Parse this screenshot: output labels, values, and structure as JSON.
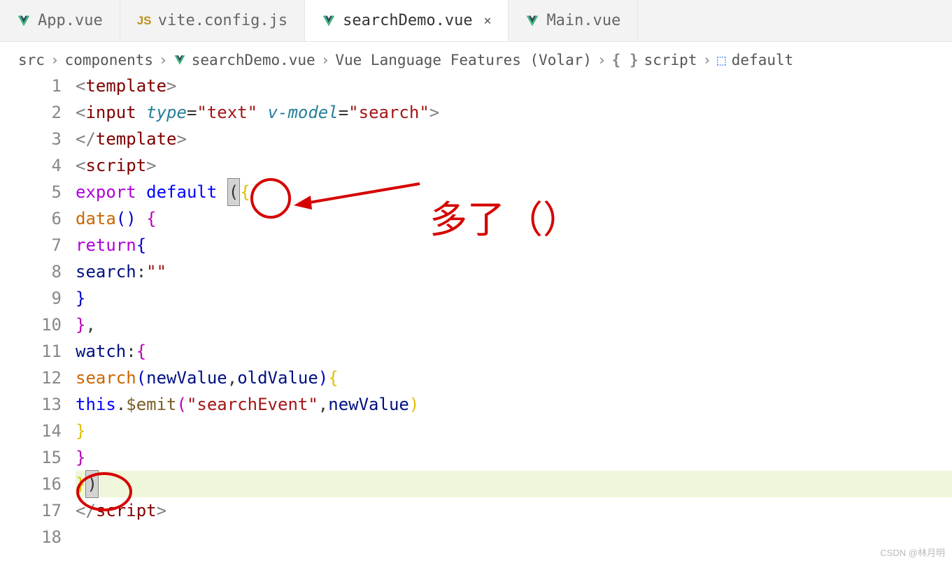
{
  "tabs": [
    {
      "label": "App.vue",
      "icon": "vue"
    },
    {
      "label": "vite.config.js",
      "icon": "js"
    },
    {
      "label": "searchDemo.vue",
      "icon": "vue",
      "active": true,
      "closable": true
    },
    {
      "label": "Main.vue",
      "icon": "vue"
    }
  ],
  "breadcrumb": {
    "parts": [
      "src",
      "components",
      "searchDemo.vue",
      "Vue Language Features (Volar)",
      "script",
      "default"
    ],
    "sep": "›"
  },
  "lineNumbers": [
    "1",
    "2",
    "3",
    "4",
    "5",
    "6",
    "7",
    "8",
    "9",
    "10",
    "11",
    "12",
    "13",
    "14",
    "15",
    "16",
    "17",
    "18"
  ],
  "code": {
    "l1": {
      "a": "<",
      "b": "template",
      "c": ">"
    },
    "l2": {
      "a": "<",
      "b": "input",
      "sp": " ",
      "attr1": "type",
      "eq": "=",
      "v1": "\"text\"",
      "sp2": " ",
      "attr2": "v-model",
      "eq2": "=",
      "v2": "\"search\"",
      "c": ">"
    },
    "l3": {
      "a": "</",
      "b": "template",
      "c": ">"
    },
    "l4": {
      "a": "<",
      "b": "script",
      "c": ">"
    },
    "l5": {
      "kw": "export",
      "sp": " ",
      "kw2": "default",
      "sp2": " ",
      "p": "(",
      "br": "{"
    },
    "l6": {
      "fn": "data",
      "p": "()",
      "sp": " ",
      "br": "{"
    },
    "l7": {
      "kw": "return",
      "br": "{"
    },
    "l8": {
      "id": "search",
      "c": ":",
      "str": "\"\""
    },
    "l9": {
      "br": "}"
    },
    "l10": {
      "br": "}",
      "c": ","
    },
    "l11": {
      "id": "watch",
      "c": ":",
      "br": "{"
    },
    "l12": {
      "fn": "search",
      "p1": "(",
      "a1": "newValue",
      "c": ",",
      "a2": "oldValue",
      "p2": ")",
      "br": "{"
    },
    "l13": {
      "kw": "this",
      "d": ".",
      "fn": "$emit",
      "p1": "(",
      "s": "\"searchEvent\"",
      "c": ",",
      "a": "newValue",
      "p2": ")"
    },
    "l14": {
      "br": "}"
    },
    "l15": {
      "br": "}"
    },
    "l16": {
      "br": "}",
      "p": ")"
    },
    "l17": {
      "a": "</",
      "b": "script",
      "c": ">"
    }
  },
  "annotation": {
    "text": "多了（）"
  },
  "watermark": "CSDN @林月明"
}
